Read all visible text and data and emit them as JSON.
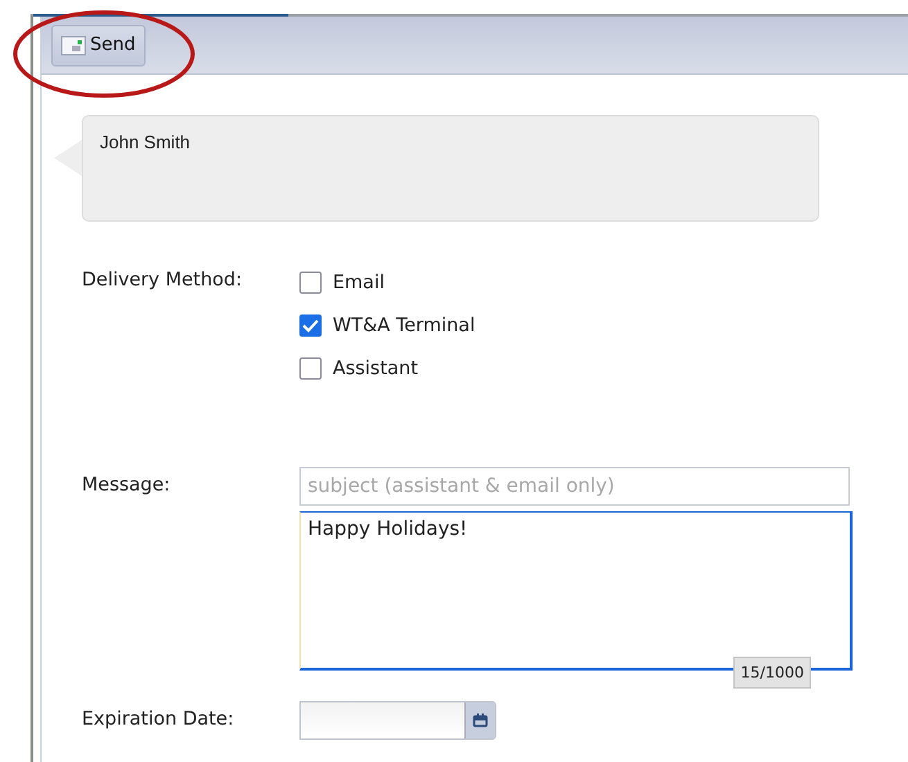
{
  "toolbar": {
    "send_button": "Send"
  },
  "recipient": {
    "name": "John Smith"
  },
  "delivery": {
    "label": "Delivery Method:",
    "options": [
      {
        "label": "Email",
        "checked": false
      },
      {
        "label": "WT&A Terminal",
        "checked": true
      },
      {
        "label": "Assistant",
        "checked": false
      }
    ]
  },
  "message": {
    "label": "Message:",
    "subject_placeholder": "subject (assistant & email only)",
    "body": "Happy Holidays!",
    "counter": "15/1000"
  },
  "expiration": {
    "label": "Expiration Date:"
  }
}
